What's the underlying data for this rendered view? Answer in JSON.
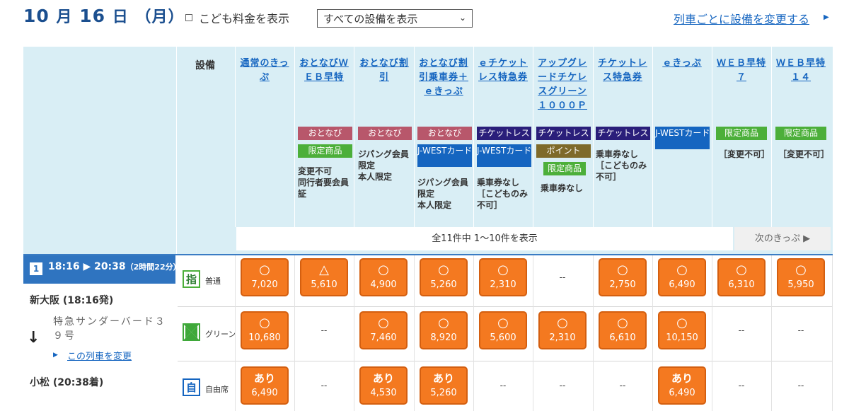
{
  "header": {
    "date_num1": "10",
    "date_mon": "月",
    "date_num2": "16",
    "date_day": "日",
    "date_wd": "（月）",
    "child_fare_label": "こども料金を表示",
    "facility_select": "すべての設備を表示",
    "change_link": "列車ごとに設備を変更する",
    "arrow_icon": "▶"
  },
  "table": {
    "facility_header": "設備",
    "columns": [
      {
        "title": "通常のきっぷ",
        "tags": [],
        "note": ""
      },
      {
        "title": "おとなびＷＥＢ早特",
        "tags": [
          {
            "text": "おとなび",
            "color": "pink"
          },
          {
            "text": "限定商品",
            "color": "green"
          }
        ],
        "note": "変更不可\n同行者要会員証"
      },
      {
        "title": "おとなび割引",
        "tags": [
          {
            "text": "おとなび",
            "color": "pink"
          }
        ],
        "note": "ジパング会員限定\n本人限定"
      },
      {
        "title": "おとなび割引乗車券＋ｅきっぷ",
        "tags": [
          {
            "text": "おとなび",
            "color": "pink"
          },
          {
            "text": "J-WESTカード",
            "color": "blue"
          }
        ],
        "note": "ジパング会員限定\n本人限定"
      },
      {
        "title": "ｅチケットレス特急券",
        "tags": [
          {
            "text": "チケットレス",
            "color": "navy"
          },
          {
            "text": "J-WESTカード",
            "color": "blue"
          }
        ],
        "note": "乗車券なし\n［こどものみ不可］"
      },
      {
        "title": "アップグレードチケレスグリーン１０００Ｐ",
        "tags": [
          {
            "text": "チケットレス",
            "color": "navy"
          },
          {
            "text": "ポイント",
            "color": "olive"
          },
          {
            "text": "限定商品",
            "color": "green"
          }
        ],
        "note": "乗車券なし"
      },
      {
        "title": "チケットレス特急券",
        "tags": [
          {
            "text": "チケットレス",
            "color": "navy"
          }
        ],
        "note": "乗車券なし\n［こどものみ不可］"
      },
      {
        "title": "ｅきっぷ",
        "tags": [
          {
            "text": "J-WESTカード",
            "color": "blue"
          }
        ],
        "note": ""
      },
      {
        "title": "ＷＥＢ早特７",
        "tags": [
          {
            "text": "限定商品",
            "color": "green"
          }
        ],
        "note": "［変更不可］"
      },
      {
        "title": "ＷＥＢ早特１４",
        "tags": [
          {
            "text": "限定商品",
            "color": "green"
          }
        ],
        "note": "［変更不可］"
      }
    ],
    "count_text": "全11件中 1〜10件を表示",
    "next_label": "次のきっぷ ▶"
  },
  "train": {
    "number": "1",
    "time": "18:16 ▶ 20:38",
    "duration": "（2時間22分）",
    "dep_station": "新大阪 (18:16発)",
    "name": "特急サンダーバード３９号",
    "change_label": "この列車を変更",
    "arr_station": "小松 (20:38着)"
  },
  "seats": [
    {
      "icon_char": "指",
      "icon": "reserved-seat-icon",
      "label": "普通",
      "fares": [
        {
          "sym": "○",
          "price": "7,020"
        },
        {
          "sym": "△",
          "price": "5,610"
        },
        {
          "sym": "○",
          "price": "4,900"
        },
        {
          "sym": "○",
          "price": "5,260"
        },
        {
          "sym": "○",
          "price": "2,310"
        },
        {
          "dash": "--"
        },
        {
          "sym": "○",
          "price": "2,750"
        },
        {
          "sym": "○",
          "price": "6,490"
        },
        {
          "sym": "○",
          "price": "6,310"
        },
        {
          "sym": "○",
          "price": "5,950"
        }
      ]
    },
    {
      "icon_char": "",
      "icon": "green-car-icon",
      "label": "グリーン",
      "fares": [
        {
          "sym": "○",
          "price": "10,680"
        },
        {
          "dash": "--"
        },
        {
          "sym": "○",
          "price": "7,460"
        },
        {
          "sym": "○",
          "price": "8,920"
        },
        {
          "sym": "○",
          "price": "5,600"
        },
        {
          "sym": "○",
          "price": "2,310"
        },
        {
          "sym": "○",
          "price": "6,610"
        },
        {
          "sym": "○",
          "price": "10,150"
        },
        {
          "dash": "--"
        },
        {
          "dash": "--"
        }
      ]
    },
    {
      "icon_char": "自",
      "icon": "non-reserved-seat-icon",
      "label": "自由席",
      "fares": [
        {
          "sym": "あり",
          "price": "6,490"
        },
        {
          "dash": "--"
        },
        {
          "sym": "あり",
          "price": "4,530"
        },
        {
          "sym": "あり",
          "price": "5,260"
        },
        {
          "dash": "--"
        },
        {
          "dash": "--"
        },
        {
          "dash": "--"
        },
        {
          "sym": "あり",
          "price": "6,490"
        },
        {
          "dash": "--"
        },
        {
          "dash": "--"
        }
      ]
    }
  ],
  "colors": {
    "accent": "#1b4f8f",
    "fare_orange": "#f47920",
    "header_bg": "#d9eef5",
    "train_blue": "#2f74c0"
  }
}
